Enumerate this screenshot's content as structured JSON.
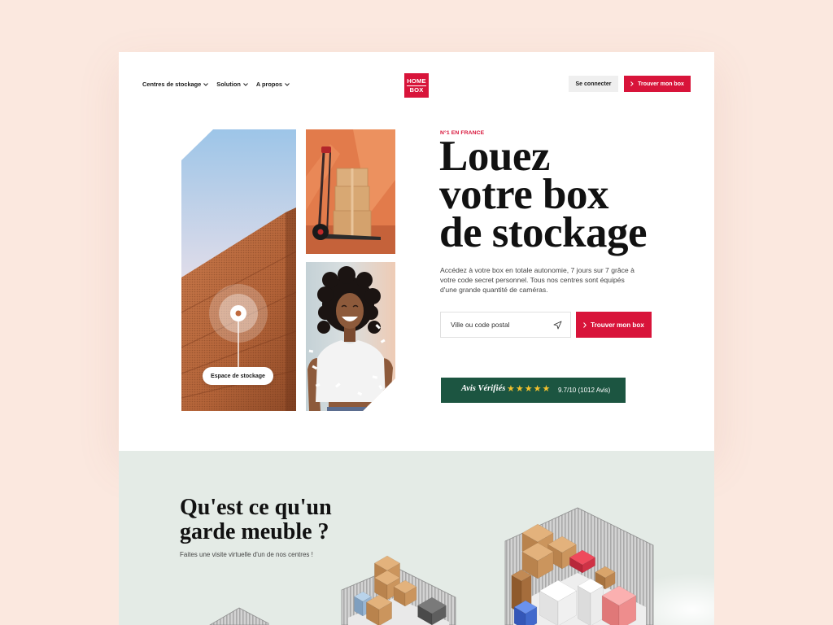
{
  "header": {
    "nav": [
      {
        "label": "Centres de stockage"
      },
      {
        "label": "Solution"
      },
      {
        "label": "A propos"
      }
    ],
    "logo": {
      "line1": "HOME",
      "line2": "BOX"
    },
    "login_label": "Se connecter",
    "cta_label": "Trouver mon box"
  },
  "hero": {
    "eyebrow": "N°1 EN FRANCE",
    "title_lines": [
      "Louez",
      "votre box",
      "de stockage"
    ],
    "description": "Accédez à votre box en totale autonomie, 7 jours sur 7 grâce à votre code secret personnel. Tous nos centres sont équipés d'une grande quantité de caméras.",
    "search": {
      "placeholder": "Ville ou code postal",
      "button_label": "Trouver mon box"
    },
    "image_tag": "Espace de stockage",
    "reviews": {
      "brand": "Avis Vérifiés",
      "stars": 5,
      "rating_label": "9.7/10 (1012 Avis)"
    }
  },
  "section2": {
    "title_lines": [
      "Qu'est ce qu'un",
      "garde meuble ?"
    ],
    "subtitle": "Faites une visite virtuelle d'un de nos centres !"
  },
  "colors": {
    "brand_red": "#d8143a",
    "reviews_green": "#1c5541",
    "star_yellow": "#f5c22e",
    "page_background": "#fbe8df",
    "section_background": "#e4ebe6"
  }
}
